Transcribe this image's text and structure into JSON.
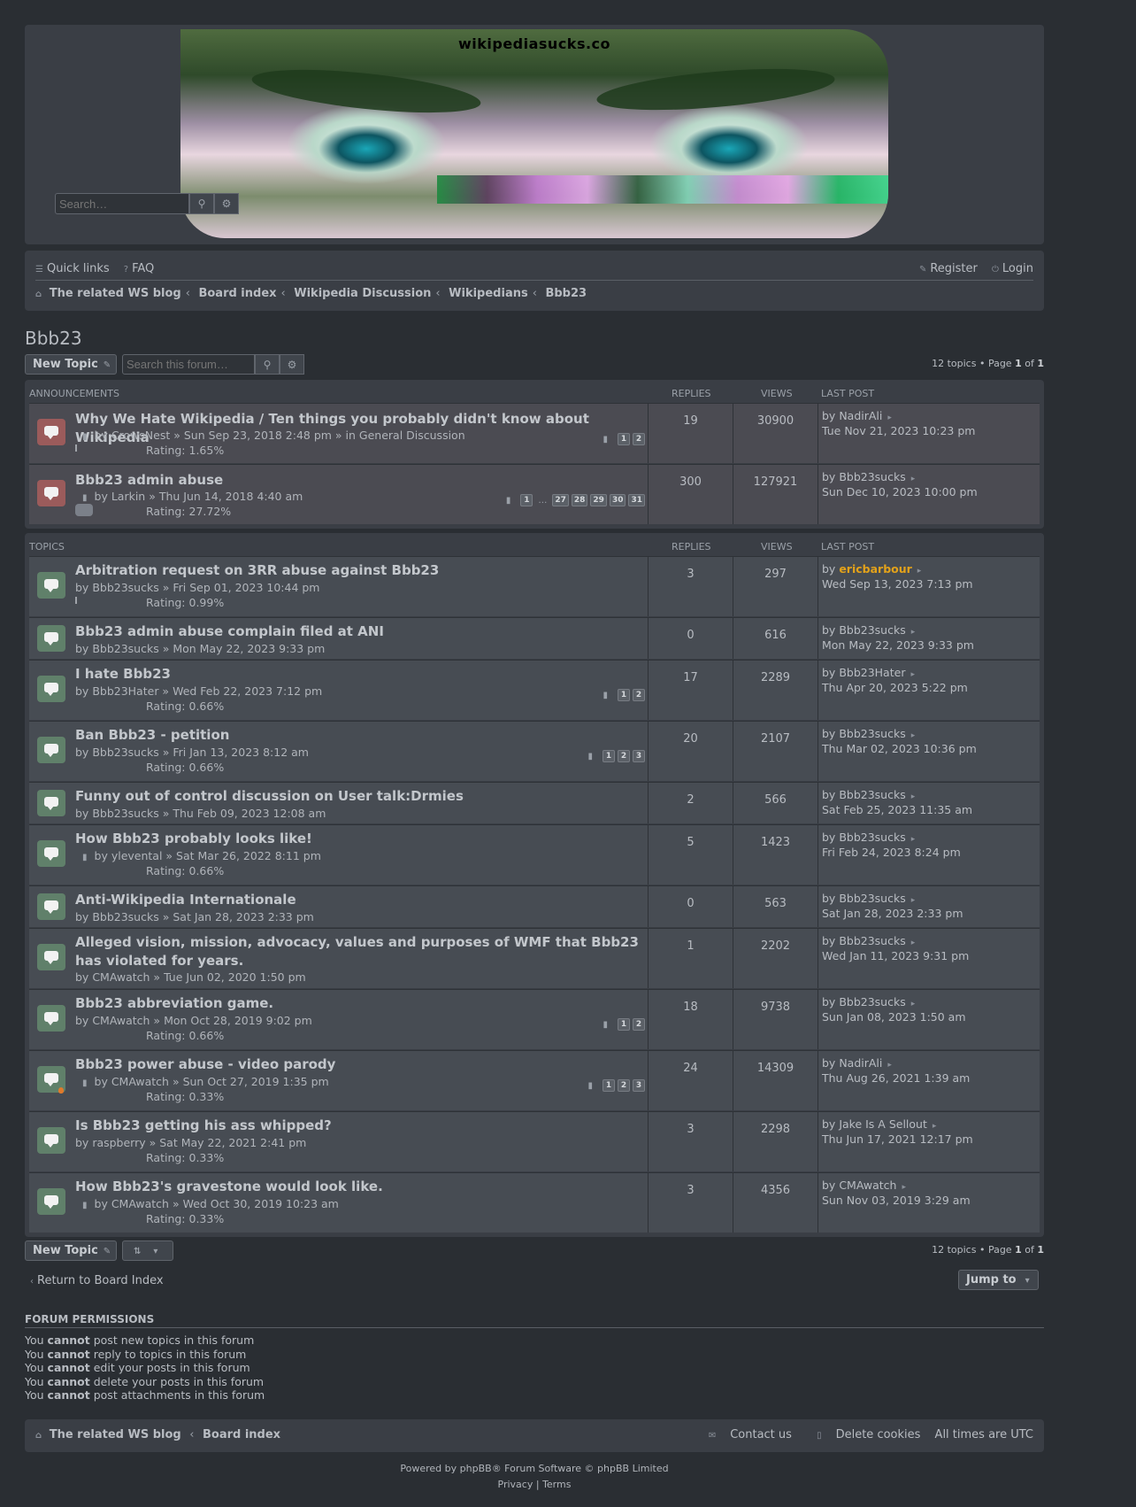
{
  "header": {
    "site_name": "wikipediasucks.co",
    "search_placeholder": "Search…",
    "search_icon": "search-icon",
    "adv_icon": "gear-icon"
  },
  "nav": {
    "quick_links": "Quick links",
    "faq": "FAQ",
    "register": "Register",
    "login": "Login",
    "breadcrumbs": [
      "The related WS blog",
      "Board index",
      "Wikipedia Discussion",
      "Wikipedians",
      "Bbb23"
    ]
  },
  "page": {
    "title": "Bbb23",
    "new_topic": "New Topic",
    "forum_search_placeholder": "Search this forum…",
    "pagination_prefix": "12 topics • Page ",
    "page_current": "1",
    "page_of": " of ",
    "page_total": "1"
  },
  "announcements": {
    "header": "ANNOUNCEMENTS",
    "col_replies": "REPLIES",
    "col_views": "VIEWS",
    "col_last": "LAST POST",
    "rows": [
      {
        "title": "Why We Hate Wikipedia / Ten things you probably didn't know about Wikipedia",
        "author": "CrowsNest",
        "date": "Sun Sep 23, 2018 2:48 pm",
        "in_forum": "General Discussion",
        "rating": "Rating: 1.65%",
        "replies": "19",
        "views": "30900",
        "last_by": "NadirAli",
        "last_date": "Tue Nov 21, 2023 10:23 pm",
        "pages": [
          "1",
          "2"
        ]
      },
      {
        "title": "Bbb23 admin abuse",
        "author": "Larkin",
        "date": "Thu Jun 14, 2018 4:40 am",
        "rating": "Rating: 27.72%",
        "replies": "300",
        "views": "127921",
        "last_by": "Bbb23sucks",
        "last_date": "Sun Dec 10, 2023 10:00 pm",
        "pages": [
          "1",
          "27",
          "28",
          "29",
          "30",
          "31"
        ]
      }
    ]
  },
  "topics": {
    "header": "TOPICS",
    "col_replies": "REPLIES",
    "col_views": "VIEWS",
    "col_last": "LAST POST",
    "rows": [
      {
        "title": "Arbitration request on 3RR abuse against Bbb23",
        "author": "Bbb23sucks",
        "date": "Fri Sep 01, 2023 10:44 pm",
        "rating": "Rating: 0.99%",
        "replies": "3",
        "views": "297",
        "last_by": "ericbarbour",
        "last_date": "Wed Sep 13, 2023 7:13 pm"
      },
      {
        "title": "Bbb23 admin abuse complain filed at ANI",
        "author": "Bbb23sucks",
        "date": "Mon May 22, 2023 9:33 pm",
        "replies": "0",
        "views": "616",
        "last_by": "Bbb23sucks",
        "last_date": "Mon May 22, 2023 9:33 pm"
      },
      {
        "title": "I hate Bbb23",
        "author": "Bbb23Hater",
        "date": "Wed Feb 22, 2023 7:12 pm",
        "rating": "Rating: 0.66%",
        "replies": "17",
        "views": "2289",
        "last_by": "Bbb23Hater",
        "last_date": "Thu Apr 20, 2023 5:22 pm",
        "pages": [
          "1",
          "2"
        ]
      },
      {
        "title": "Ban Bbb23 - petition",
        "author": "Bbb23sucks",
        "date": "Fri Jan 13, 2023 8:12 am",
        "rating": "Rating: 0.66%",
        "replies": "20",
        "views": "2107",
        "last_by": "Bbb23sucks",
        "last_date": "Thu Mar 02, 2023 10:36 pm",
        "pages": [
          "1",
          "2",
          "3"
        ]
      },
      {
        "title": "Funny out of control discussion on User talk:Drmies",
        "author": "Bbb23sucks",
        "date": "Thu Feb 09, 2023 12:08 am",
        "replies": "2",
        "views": "566",
        "last_by": "Bbb23sucks",
        "last_date": "Sat Feb 25, 2023 11:35 am"
      },
      {
        "title": "How Bbb23 probably looks like!",
        "author": "ylevental",
        "date": "Sat Mar 26, 2022 8:11 pm",
        "rating": "Rating: 0.66%",
        "replies": "5",
        "views": "1423",
        "last_by": "Bbb23sucks",
        "last_date": "Fri Feb 24, 2023 8:24 pm"
      },
      {
        "title": "Anti-Wikipedia Internationale",
        "author": "Bbb23sucks",
        "date": "Sat Jan 28, 2023 2:33 pm",
        "replies": "0",
        "views": "563",
        "last_by": "Bbb23sucks",
        "last_date": "Sat Jan 28, 2023 2:33 pm"
      },
      {
        "title": "Alleged vision, mission, advocacy, values and purposes of WMF that Bbb23 has violated for years.",
        "author": "CMAwatch",
        "date": "Tue Jun 02, 2020 1:50 pm",
        "replies": "1",
        "views": "2202",
        "last_by": "Bbb23sucks",
        "last_date": "Wed Jan 11, 2023 9:31 pm"
      },
      {
        "title": "Bbb23 abbreviation game.",
        "author": "CMAwatch",
        "date": "Mon Oct 28, 2019 9:02 pm",
        "rating": "Rating: 0.66%",
        "replies": "18",
        "views": "9738",
        "last_by": "Bbb23sucks",
        "last_date": "Sun Jan 08, 2023 1:50 am",
        "pages": [
          "1",
          "2"
        ]
      },
      {
        "title": "Bbb23 power abuse - video parody",
        "author": "CMAwatch",
        "date": "Sun Oct 27, 2019 1:35 pm",
        "rating": "Rating: 0.33%",
        "replies": "24",
        "views": "14309",
        "last_by": "NadirAli",
        "last_date": "Thu Aug 26, 2021 1:39 am",
        "pages": [
          "1",
          "2",
          "3"
        ]
      },
      {
        "title": "Is Bbb23 getting his ass whipped?",
        "author": "raspberry",
        "date": "Sat May 22, 2021 2:41 pm",
        "rating": "Rating: 0.33%",
        "replies": "3",
        "views": "2298",
        "last_by": "Jake Is A Sellout",
        "last_date": "Thu Jun 17, 2021 12:17 pm"
      },
      {
        "title": "How Bbb23's gravestone would look like.",
        "author": "CMAwatch",
        "date": "Wed Oct 30, 2019 10:23 am",
        "rating": "Rating: 0.33%",
        "replies": "3",
        "views": "4356",
        "last_by": "CMAwatch",
        "last_date": "Sun Nov 03, 2019 3:29 am"
      }
    ]
  },
  "bottom": {
    "return_link": "Return to Board Index",
    "jump_to": "Jump to"
  },
  "permissions": {
    "title": "FORUM PERMISSIONS",
    "lines": [
      {
        "pre": "You ",
        "bold": "cannot",
        "post": " post new topics in this forum"
      },
      {
        "pre": "You ",
        "bold": "cannot",
        "post": " reply to topics in this forum"
      },
      {
        "pre": "You ",
        "bold": "cannot",
        "post": " edit your posts in this forum"
      },
      {
        "pre": "You ",
        "bold": "cannot",
        "post": " delete your posts in this forum"
      },
      {
        "pre": "You ",
        "bold": "cannot",
        "post": " post attachments in this forum"
      }
    ]
  },
  "footer": {
    "crumb1": "The related WS blog",
    "crumb2": "Board index",
    "contact": "Contact us",
    "delete_cookies": "Delete cookies",
    "timezone": "All times are UTC",
    "powered_pre": "Powered by ",
    "powered_link": "phpBB",
    "powered_post": "® Forum Software © phpBB Limited",
    "privacy": "Privacy",
    "sep": " | ",
    "terms": "Terms"
  },
  "colors": {
    "accent_gold": "#e3a21a",
    "announce_icon": "#9b5b5b",
    "topic_icon": "#60806a"
  }
}
